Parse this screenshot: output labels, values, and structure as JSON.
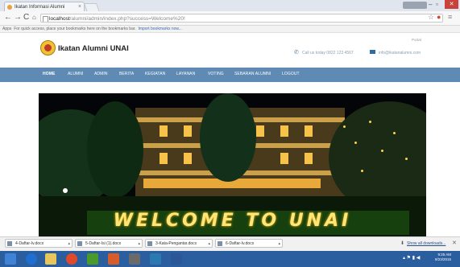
{
  "browser": {
    "tab_title": "Ikatan Informasi Alumni",
    "tab_close": "×",
    "url_host": "localhost",
    "url_path": "/alumni/admin/index.php?success=Welcome%20!",
    "bookmarks_prefix": "Apps",
    "bookmarks_text": "For quick access, place your bookmarks here on the bookmarks bar.",
    "bookmarks_link": "Import bookmarks now..."
  },
  "site": {
    "title": "Ikatan Alumni UNAI",
    "portal_label": "Portal",
    "phone_text": "Call us today 0822 123 4567",
    "email_text": "info@ikatanalumni.com",
    "nav": [
      "HOME",
      "ALUMNI",
      "ADMIN",
      "BERITA",
      "KEGIATAN",
      "LAYANAN",
      "VOTING",
      "SEBARAN ALUMNI",
      "LOGOUT"
    ],
    "hero_text": "WELCOME TO UNAI"
  },
  "downloads": {
    "items": [
      "4-Daftar-Iv.docx",
      "5-Daftar-Isi (1).docx",
      "3-Kata-Pengantar.docx",
      "6-Daftar-Iv.docx"
    ],
    "show_all": "Show all downloads..."
  },
  "taskbar": {
    "time": "9:25 AM",
    "date": "8/23/2015"
  },
  "colors": {
    "navbar": "#5f8ab3",
    "taskbar": "#2a5e9e",
    "welcome_text": "#ffe67a"
  }
}
